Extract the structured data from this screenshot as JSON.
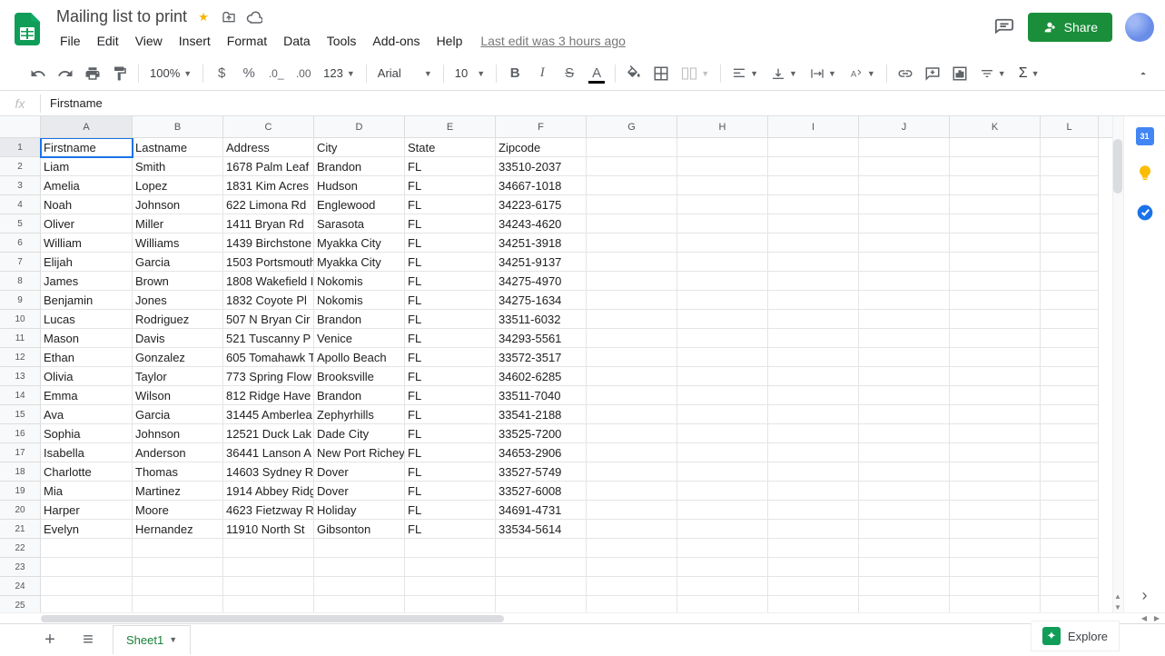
{
  "doc_title": "Mailing list to print",
  "last_edit": "Last edit was 3 hours ago",
  "menus": [
    "File",
    "Edit",
    "View",
    "Insert",
    "Format",
    "Data",
    "Tools",
    "Add-ons",
    "Help"
  ],
  "toolbar": {
    "zoom": "100%",
    "font": "Arial",
    "font_size": "10",
    "more_fmt": "123"
  },
  "share_label": "Share",
  "formula_value": "Firstname",
  "columns": [
    "A",
    "B",
    "C",
    "D",
    "E",
    "F",
    "G",
    "H",
    "I",
    "J",
    "K",
    "L"
  ],
  "selected_cell": "A1",
  "headers": [
    "Firstname",
    "Lastname",
    "Address",
    "City",
    "State",
    "Zipcode"
  ],
  "rows": [
    [
      "Liam",
      "Smith",
      "1678 Palm Leaf",
      "Brandon",
      "FL",
      "33510-2037"
    ],
    [
      "Amelia",
      "Lopez",
      "1831 Kim Acres",
      "Hudson",
      "FL",
      "34667-1018"
    ],
    [
      "Noah",
      "Johnson",
      "622 Limona Rd",
      "Englewood",
      "FL",
      "34223-6175"
    ],
    [
      "Oliver",
      "Miller",
      "1411 Bryan Rd",
      "Sarasota",
      "FL",
      "34243-4620"
    ],
    [
      "William",
      "Williams",
      "1439 Birchstone",
      "Myakka City",
      "FL",
      "34251-3918"
    ],
    [
      "Elijah",
      "Garcia",
      "1503 Portsmouth",
      "Myakka City",
      "FL",
      "34251-9137"
    ],
    [
      "James",
      "Brown",
      "1808 Wakefield I",
      "Nokomis",
      "FL",
      "34275-4970"
    ],
    [
      "Benjamin",
      "Jones",
      "1832 Coyote Pl",
      "Nokomis",
      "FL",
      "34275-1634"
    ],
    [
      "Lucas",
      "Rodriguez",
      "507 N Bryan Cir",
      "Brandon",
      "FL",
      "33511-6032"
    ],
    [
      "Mason",
      "Davis",
      "521 Tuscanny P",
      "Venice",
      "FL",
      "34293-5561"
    ],
    [
      "Ethan",
      "Gonzalez",
      "605 Tomahawk T",
      "Apollo Beach",
      "FL",
      "33572-3517"
    ],
    [
      "Olivia",
      "Taylor",
      "773 Spring Flow",
      "Brooksville",
      "FL",
      "34602-6285"
    ],
    [
      "Emma",
      "Wilson",
      "812 Ridge Have",
      "Brandon",
      "FL",
      "33511-7040"
    ],
    [
      "Ava",
      "Garcia",
      "31445 Amberlea",
      "Zephyrhills",
      "FL",
      "33541-2188"
    ],
    [
      "Sophia",
      "Johnson",
      "12521 Duck Lak",
      "Dade City",
      "FL",
      "33525-7200"
    ],
    [
      "Isabella",
      "Anderson",
      "36441 Lanson A",
      "New Port Richey",
      "FL",
      "34653-2906"
    ],
    [
      "Charlotte",
      "Thomas",
      "14603 Sydney R",
      "Dover",
      "FL",
      "33527-5749"
    ],
    [
      "Mia",
      "Martinez",
      "1914 Abbey Ridg",
      "Dover",
      "FL",
      "33527-6008"
    ],
    [
      "Harper",
      "Moore",
      "4623 Fietzway R",
      "Holiday",
      "FL",
      "34691-4731"
    ],
    [
      "Evelyn",
      "Hernandez",
      "11910 North St",
      "Gibsonton",
      "FL",
      "33534-5614"
    ]
  ],
  "empty_rows": [
    22,
    23,
    24,
    25
  ],
  "sheet_tab": "Sheet1",
  "explore_label": "Explore"
}
